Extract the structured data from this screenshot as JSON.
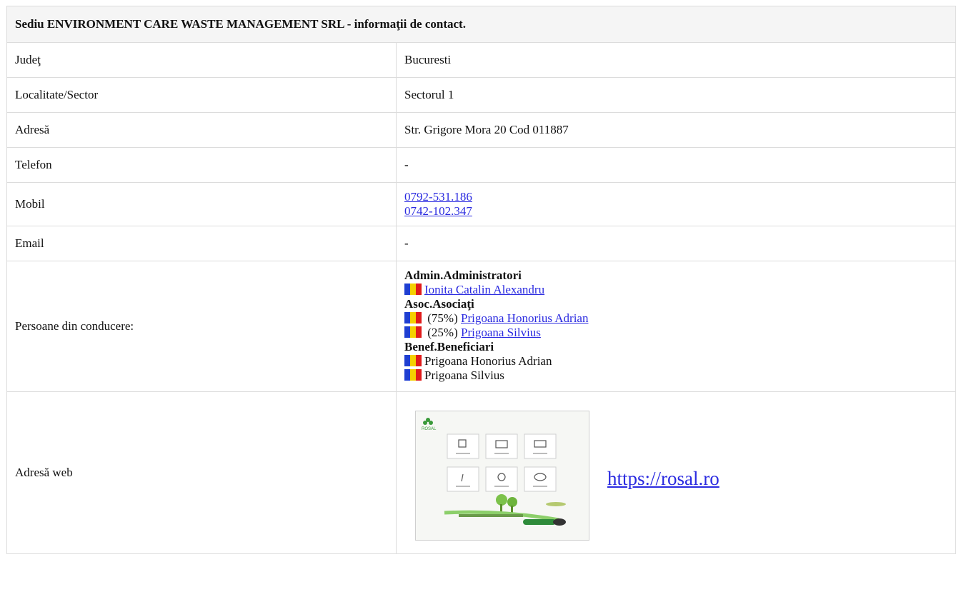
{
  "header": {
    "title": "Sediu ENVIRONMENT CARE WASTE MANAGEMENT SRL - informaţii de contact."
  },
  "rows": {
    "judet": {
      "label": "Judeţ",
      "value": "Bucuresti"
    },
    "localitate": {
      "label": "Localitate/Sector",
      "value": "Sectorul 1"
    },
    "adresa": {
      "label": "Adresă",
      "value": "Str. Grigore Mora 20 Cod 011887"
    },
    "telefon": {
      "label": "Telefon",
      "value": "-"
    },
    "mobil": {
      "label": "Mobil",
      "phones": [
        "0792-531.186",
        "0742-102.347"
      ]
    },
    "email": {
      "label": "Email",
      "value": "-"
    },
    "persoane": {
      "label": "Persoane din conducere:",
      "admin_heading": "Admin.Administratori",
      "admin": [
        "Ionita Catalin Alexandru"
      ],
      "asoc_heading": "Asoc.Asociaţi",
      "asoc": [
        {
          "share": "(75%)",
          "name": "Prigoana Honorius Adrian"
        },
        {
          "share": "(25%)",
          "name": "Prigoana Silvius"
        }
      ],
      "benef_heading": "Benef.Beneficiari",
      "benef": [
        "Prigoana Honorius Adrian",
        "Prigoana Silvius"
      ]
    },
    "web": {
      "label": "Adresă web",
      "url": "https://rosal.ro",
      "thumb_brand": "ROSAL"
    }
  },
  "colors": {
    "link": "#2a2ae0",
    "header_bg": "#f5f5f5",
    "border": "#dcdcdc"
  },
  "icons": [
    "flag-romania-icon"
  ]
}
